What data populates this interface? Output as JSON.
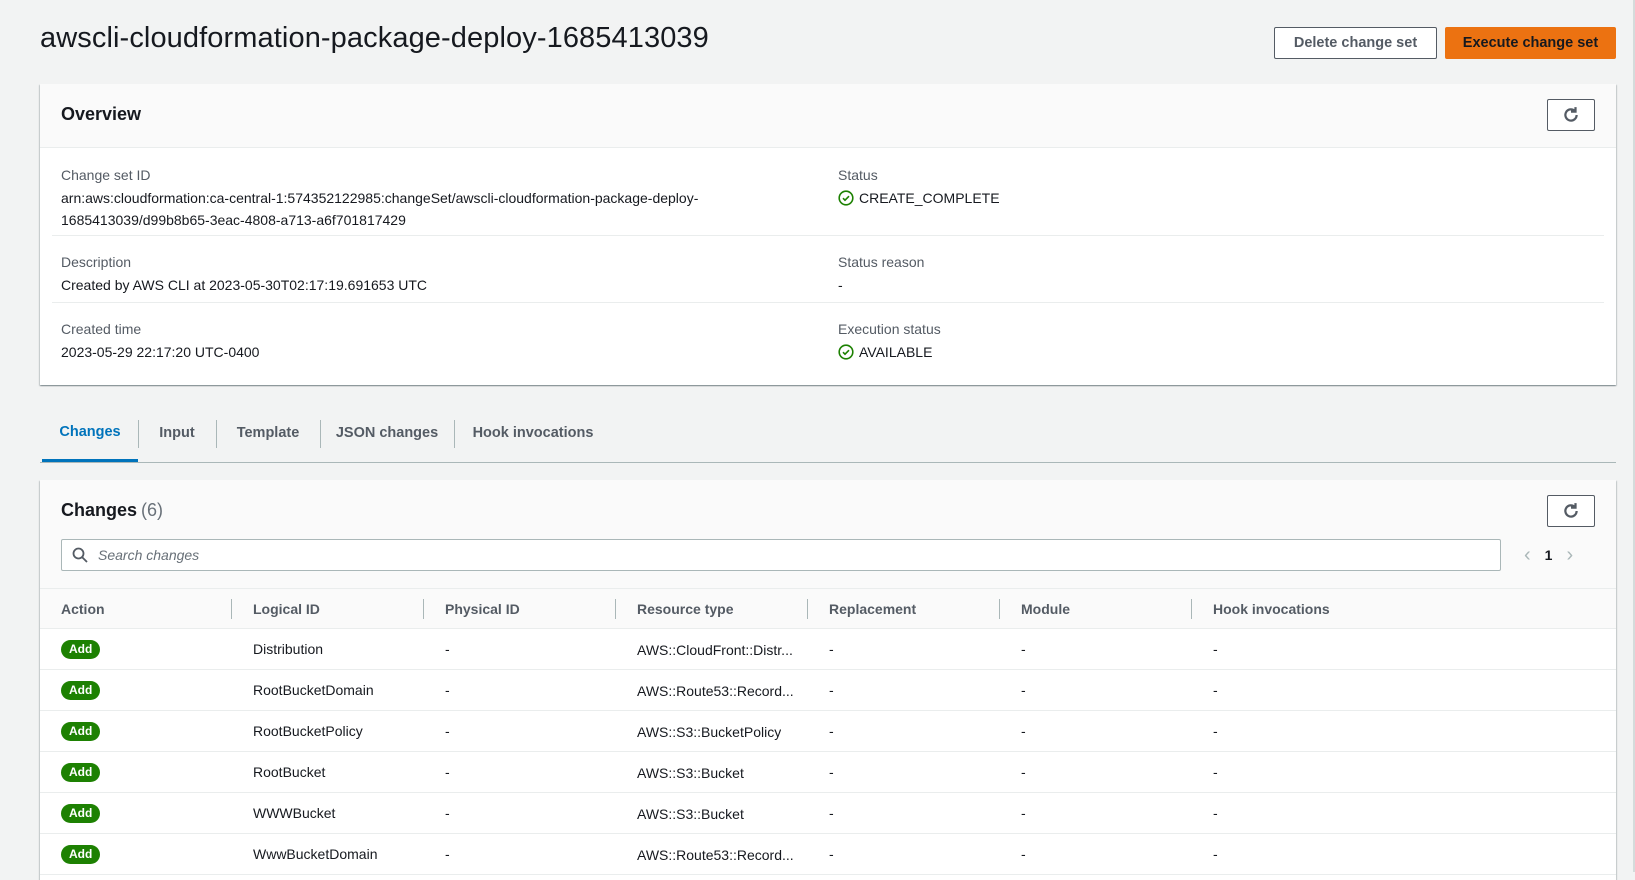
{
  "page": {
    "title": "awscli-cloudformation-package-deploy-1685413039",
    "delete_button": "Delete change set",
    "execute_button": "Execute change set"
  },
  "overview": {
    "heading": "Overview",
    "change_set_id_label": "Change set ID",
    "change_set_id_line1": "arn:aws:cloudformation:ca-central-1:574352122985:changeSet/awscli-cloudformation-package-deploy-",
    "change_set_id_line2": "1685413039/d99b8b65-3eac-4808-a713-a6f701817429",
    "status_label": "Status",
    "status_value": "CREATE_COMPLETE",
    "description_label": "Description",
    "description_value": "Created by AWS CLI at 2023-05-30T02:17:19.691653 UTC",
    "status_reason_label": "Status reason",
    "status_reason_value": "-",
    "created_time_label": "Created time",
    "created_time_value": "2023-05-29 22:17:20 UTC-0400",
    "execution_status_label": "Execution status",
    "execution_status_value": "AVAILABLE"
  },
  "tabs": [
    "Changes",
    "Input",
    "Template",
    "JSON changes",
    "Hook invocations"
  ],
  "changes": {
    "heading": "Changes",
    "count": "(6)",
    "search_placeholder": "Search changes",
    "page_number": "1",
    "columns": [
      "Action",
      "Logical ID",
      "Physical ID",
      "Resource type",
      "Replacement",
      "Module",
      "Hook invocations"
    ],
    "rows": [
      {
        "action": "Add",
        "logical_id": "Distribution",
        "physical_id": "-",
        "resource_type": "AWS::CloudFront::Distr...",
        "replacement": "-",
        "module": "-",
        "hook": "-"
      },
      {
        "action": "Add",
        "logical_id": "RootBucketDomain",
        "physical_id": "-",
        "resource_type": "AWS::Route53::Record...",
        "replacement": "-",
        "module": "-",
        "hook": "-"
      },
      {
        "action": "Add",
        "logical_id": "RootBucketPolicy",
        "physical_id": "-",
        "resource_type": "AWS::S3::BucketPolicy",
        "replacement": "-",
        "module": "-",
        "hook": "-"
      },
      {
        "action": "Add",
        "logical_id": "RootBucket",
        "physical_id": "-",
        "resource_type": "AWS::S3::Bucket",
        "replacement": "-",
        "module": "-",
        "hook": "-"
      },
      {
        "action": "Add",
        "logical_id": "WWWBucket",
        "physical_id": "-",
        "resource_type": "AWS::S3::Bucket",
        "replacement": "-",
        "module": "-",
        "hook": "-"
      },
      {
        "action": "Add",
        "logical_id": "WwwBucketDomain",
        "physical_id": "-",
        "resource_type": "AWS::Route53::Record...",
        "replacement": "-",
        "module": "-",
        "hook": "-"
      }
    ]
  },
  "colors": {
    "primary_button": "#ec7211",
    "success": "#1d8102",
    "active_tab": "#0073bb"
  }
}
